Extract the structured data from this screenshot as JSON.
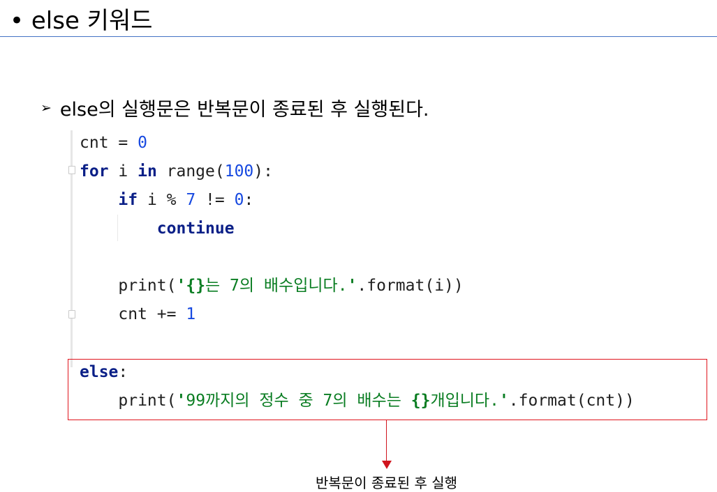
{
  "slide": {
    "title": "• else 키워드",
    "bullet_marker": "➢",
    "bullet_text": "else의 실행문은 반복문이 종료된 후 실행된다."
  },
  "code": {
    "line1": {
      "name": "cnt",
      "op": " = ",
      "value": "0"
    },
    "line2": {
      "kw_for": "for",
      "var": " i ",
      "kw_in": "in",
      "call": " range(",
      "arg": "100",
      "close": "):"
    },
    "line3": {
      "indent": "    ",
      "kw_if": "if",
      "expr": " i % ",
      "n1": "7",
      "op": " != ",
      "n2": "0",
      "colon": ":"
    },
    "line4": {
      "indent": "        ",
      "kw_continue": "continue"
    },
    "line5": {
      "indent": "    ",
      "call": "print(",
      "q1": "'",
      "braces": "{}",
      "text": "는 7의 배수입니다.",
      "q2": "'",
      "tail": ".format(i))"
    },
    "line6": {
      "indent": "    ",
      "name": "cnt",
      "op": " += ",
      "value": "1"
    },
    "line7": {
      "kw_else": "else",
      "colon": ":"
    },
    "line8": {
      "indent": "    ",
      "call": "print(",
      "q1": "'",
      "text_a": "99까지의 정수 중 7의 배수는 ",
      "braces": "{}",
      "text_b": "개입니다.",
      "q2": "'",
      "tail": ".format(cnt))"
    }
  },
  "annotation": {
    "caption": "반복문이 종료된 후 실행"
  },
  "colors": {
    "title_rule": "#4472c4",
    "highlight_border": "#e0141d",
    "arrow": "#d0141d",
    "keyword": "#0a1f87",
    "number": "#1749e0",
    "string": "#0a7d22"
  }
}
